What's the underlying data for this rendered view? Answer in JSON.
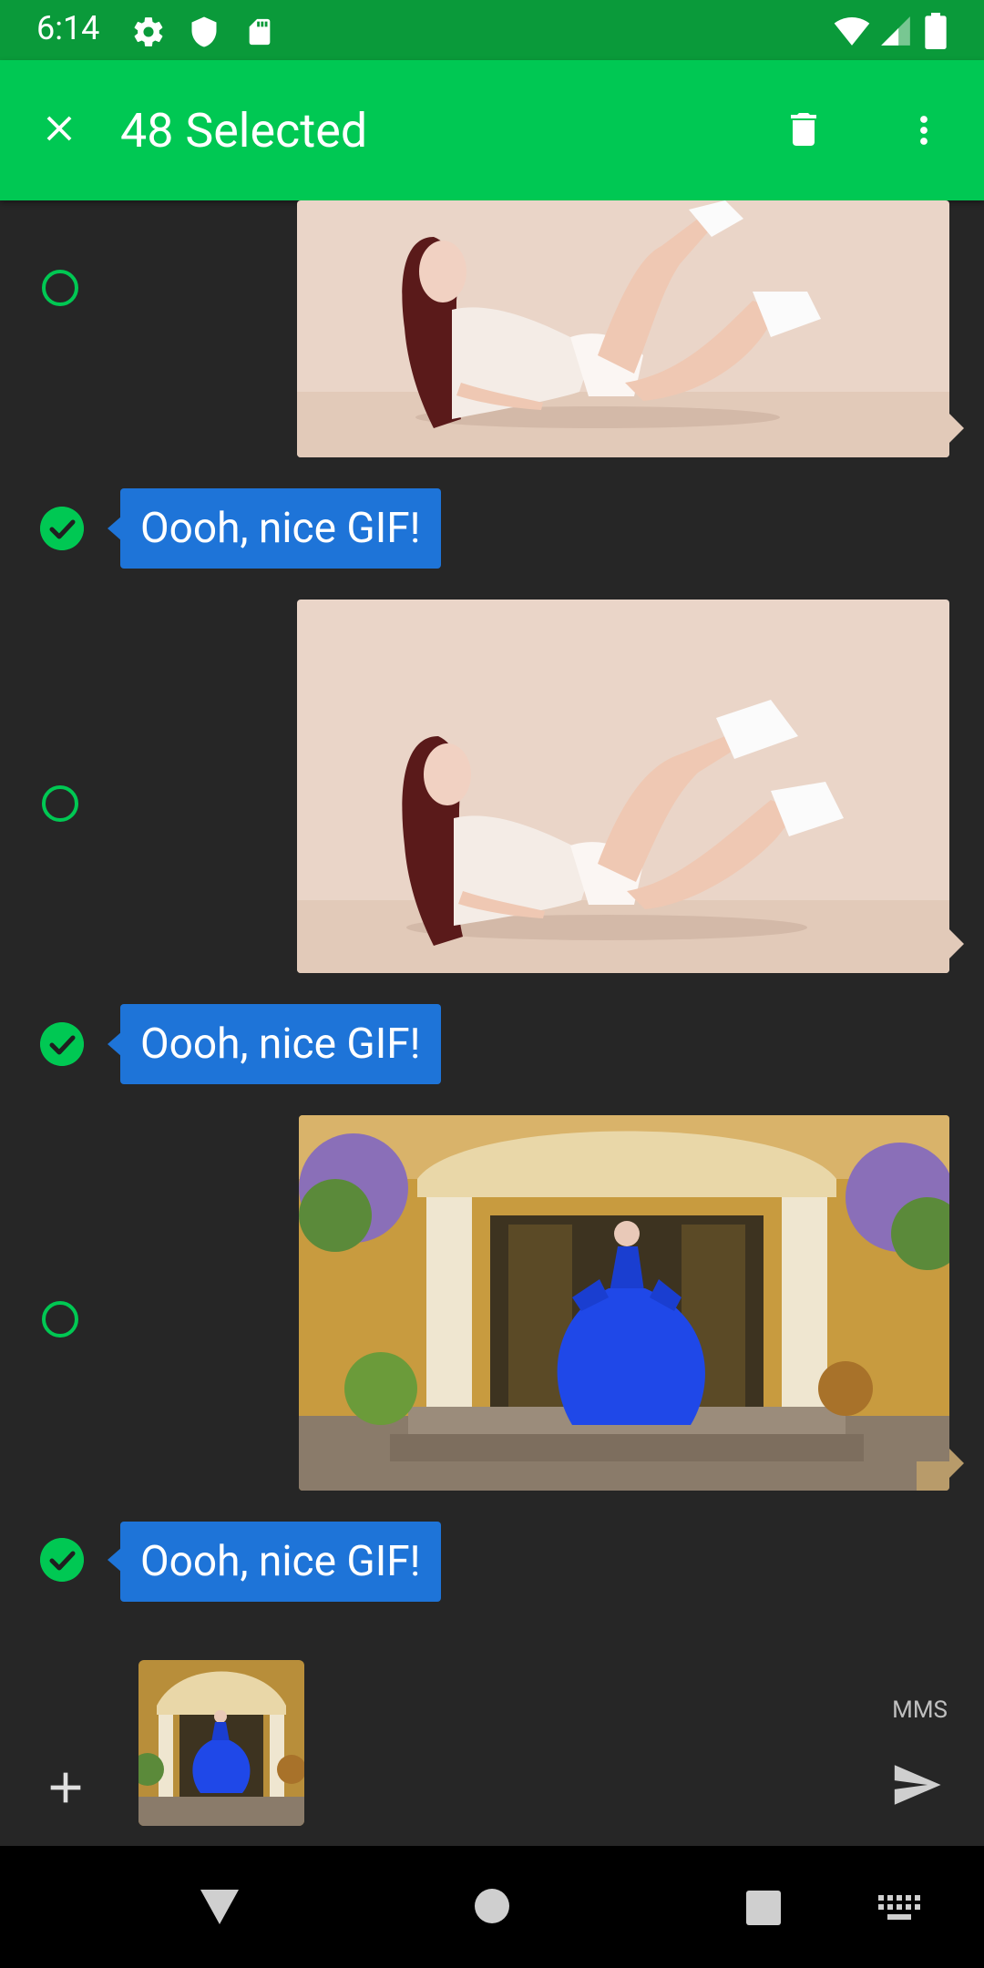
{
  "status_bar": {
    "time": "6:14"
  },
  "app_bar": {
    "title": "48 Selected"
  },
  "messages": [
    {
      "type": "media",
      "selected": false,
      "image": "gif-woman-lying-legs-up"
    },
    {
      "type": "text",
      "selected": true,
      "text": "Oooh, nice GIF!"
    },
    {
      "type": "media",
      "selected": false,
      "image": "gif-woman-lying-legs-up"
    },
    {
      "type": "text",
      "selected": true,
      "text": "Oooh, nice GIF!"
    },
    {
      "type": "media",
      "selected": false,
      "image": "gif-woman-blue-dress-porch"
    },
    {
      "type": "text",
      "selected": true,
      "text": "Oooh, nice GIF!"
    }
  ],
  "composer": {
    "attachment": "gif-woman-blue-dress-porch",
    "send_mode": "MMS"
  },
  "colors": {
    "status_bar": "#0a9a3a",
    "app_bar": "#00c853",
    "background": "#262626",
    "bubble": "#1e74d8",
    "selection": "#00c853",
    "nav_bar": "#000000"
  },
  "icons": {
    "status": [
      "settings-icon",
      "shield-icon",
      "sd-card-icon",
      "wifi-icon",
      "signal-icon",
      "battery-icon"
    ],
    "app_bar": [
      "close-icon",
      "delete-icon",
      "more-vert-icon"
    ],
    "composer": [
      "add-icon",
      "send-icon"
    ],
    "nav": [
      "back-icon",
      "home-icon",
      "recents-icon",
      "keyboard-icon"
    ]
  }
}
